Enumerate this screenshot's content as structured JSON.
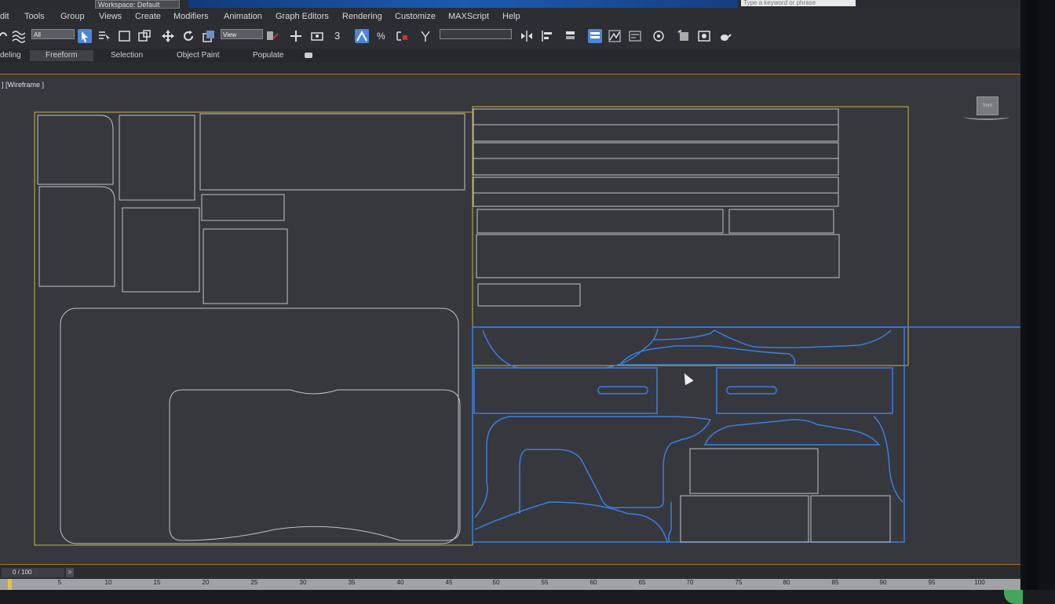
{
  "titlebar": {
    "workspace": "Workspace: Default",
    "search_placeholder": "Type a keyword or phrase"
  },
  "menu": [
    "dit",
    "Tools",
    "Group",
    "Views",
    "Create",
    "Modifiers",
    "Animation",
    "Graph Editors",
    "Rendering",
    "Customize",
    "MAXScript",
    "Help"
  ],
  "toolbar": {
    "selection_filter": "All",
    "reference_coord": "View",
    "snap_label": "3",
    "named_selection": ""
  },
  "ribbon_tabs": [
    "deling",
    "Freeform",
    "Selection",
    "Object Paint",
    "Populate"
  ],
  "ribbon_active": "Freeform",
  "viewport": {
    "label": "] [Wireframe ]",
    "viewcube_face": "front"
  },
  "timeline": {
    "frame": "0 / 100",
    "ticks": [
      "5",
      "10",
      "15",
      "20",
      "25",
      "30",
      "35",
      "40",
      "45",
      "50",
      "55",
      "60",
      "65",
      "70",
      "75",
      "80",
      "85",
      "90",
      "95",
      "100"
    ]
  },
  "colors": {
    "wire_gray": "#bfc2c8",
    "wire_blue": "#3d7ee0",
    "selection_yellow": "#c9b24a",
    "viewport_bg": "#36383d",
    "accent_orange": "#b6751d"
  }
}
